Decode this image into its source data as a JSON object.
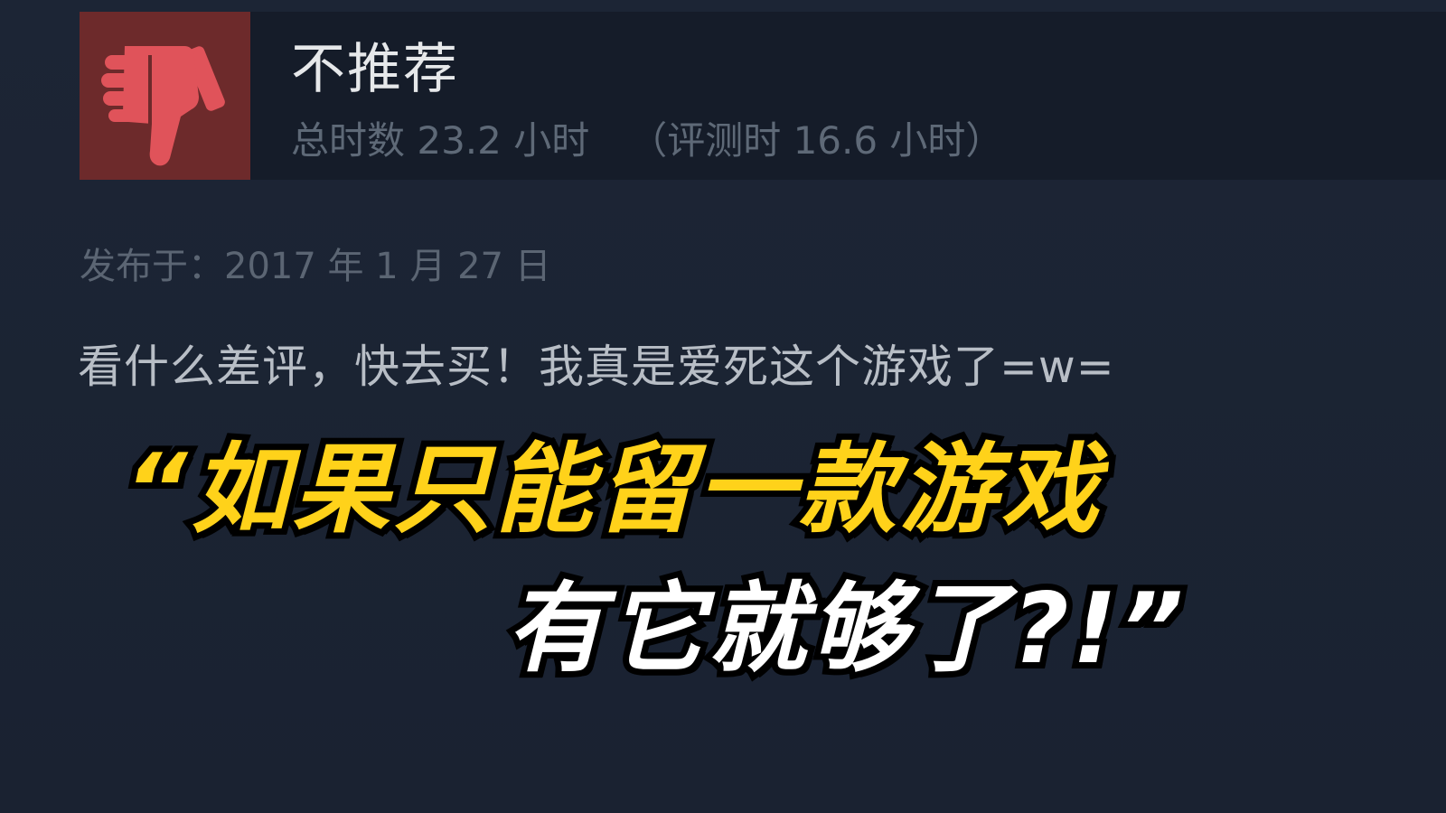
{
  "review": {
    "verdict": "不推荐",
    "icon": "thumbs-down-icon",
    "total_hours": "总时数 23.2 小时",
    "hours_at_review": "（评测时 16.6 小时）",
    "posted": "发布于：2017 年 1 月 27 日",
    "text": "看什么差评，快去买！我真是爱死这个游戏了=w="
  },
  "caption": {
    "line1": "“如果只能留一款游戏",
    "line2": "有它就够了?!”"
  },
  "colors": {
    "background": "#1c2535",
    "header_bar": "#151c29",
    "thumb_box": "#6d2a2b",
    "thumb_icon": "#e0535a",
    "caption_yellow": "#ffd21a",
    "caption_white": "#ffffff"
  }
}
